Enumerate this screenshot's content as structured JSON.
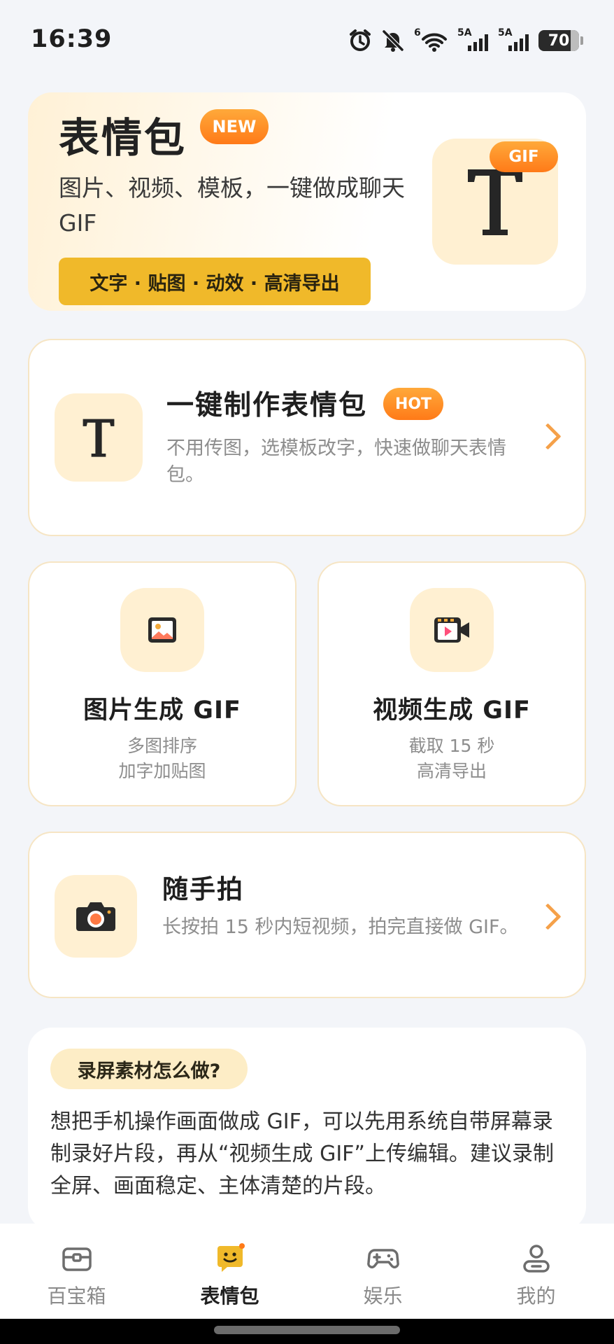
{
  "status_bar": {
    "time": "16:39",
    "network_labels": [
      "6",
      "5A",
      "5A"
    ],
    "battery": "70",
    "icons": [
      "alarm-icon",
      "mute-icon",
      "wifi-icon",
      "signal-icon",
      "signal-icon",
      "battery-icon"
    ]
  },
  "hero": {
    "title": "表情包",
    "badge": "NEW",
    "description": "图片、视频、模板，一键做成聊天 GIF",
    "features": "文字 · 贴图 · 动效 · 高清导出",
    "icon_badge": "GIF",
    "icon_glyph": "T"
  },
  "quick_make": {
    "title": "一键制作表情包",
    "badge": "HOT",
    "description": "不用传图，选模板改字，快速做聊天表情包。",
    "icon_glyph": "T"
  },
  "image_gif": {
    "title": "图片生成 GIF",
    "line1": "多图排序",
    "line2": "加字加贴图"
  },
  "video_gif": {
    "title": "视频生成 GIF",
    "line1": "截取 15 秒",
    "line2": "高清导出"
  },
  "snap": {
    "title": "随手拍",
    "description": "长按拍 15 秒内短视频，拍完直接做 GIF。"
  },
  "tip": {
    "tag": "录屏素材怎么做?",
    "text": "想把手机操作画面做成 GIF，可以先用系统自带屏幕录制录好片段，再从“视频生成 GIF”上传编辑。建议录制全屏、画面稳定、主体清楚的片段。"
  },
  "tabbar": {
    "active": "表情包",
    "tabs": [
      {
        "label": "百宝箱",
        "icon": "toolbox-icon"
      },
      {
        "label": "表情包",
        "icon": "emoji-icon"
      },
      {
        "label": "娱乐",
        "icon": "gamepad-icon"
      },
      {
        "label": "我的",
        "icon": "user-icon"
      }
    ]
  },
  "colors": {
    "accent_orange": "#ff8a24",
    "accent_yellow": "#f0b92a",
    "icon_bg": "#fff0d2",
    "chevron": "#f5a14a"
  }
}
